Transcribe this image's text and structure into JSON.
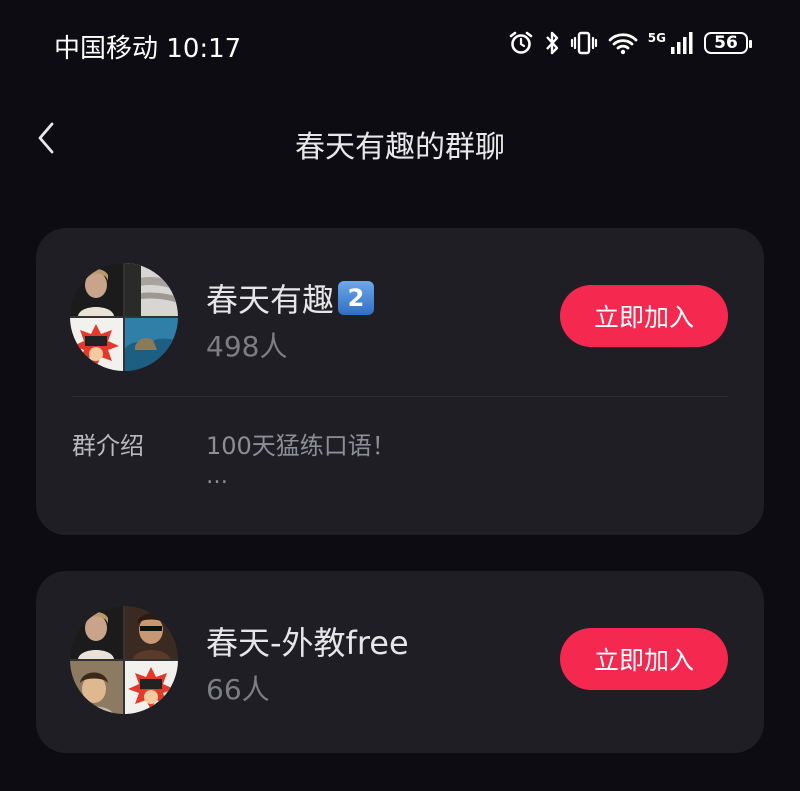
{
  "status_bar": {
    "carrier": "中国移动",
    "time": "10:17",
    "network_label": "5G",
    "battery": "56"
  },
  "nav": {
    "title": "春天有趣的群聊"
  },
  "groups": [
    {
      "name": "春天有趣",
      "badge": "2",
      "members": "498人",
      "join_label": "立即加入",
      "intro_label": "群介绍",
      "intro_text": "100天猛练口语！",
      "intro_more": "…"
    },
    {
      "name": "春天-外教free",
      "members": "66人",
      "join_label": "立即加入"
    }
  ],
  "colors": {
    "background": "#0c0c12",
    "card": "#1e1e24",
    "join_button": "#f5284f",
    "badge": "#2f6fc4"
  }
}
